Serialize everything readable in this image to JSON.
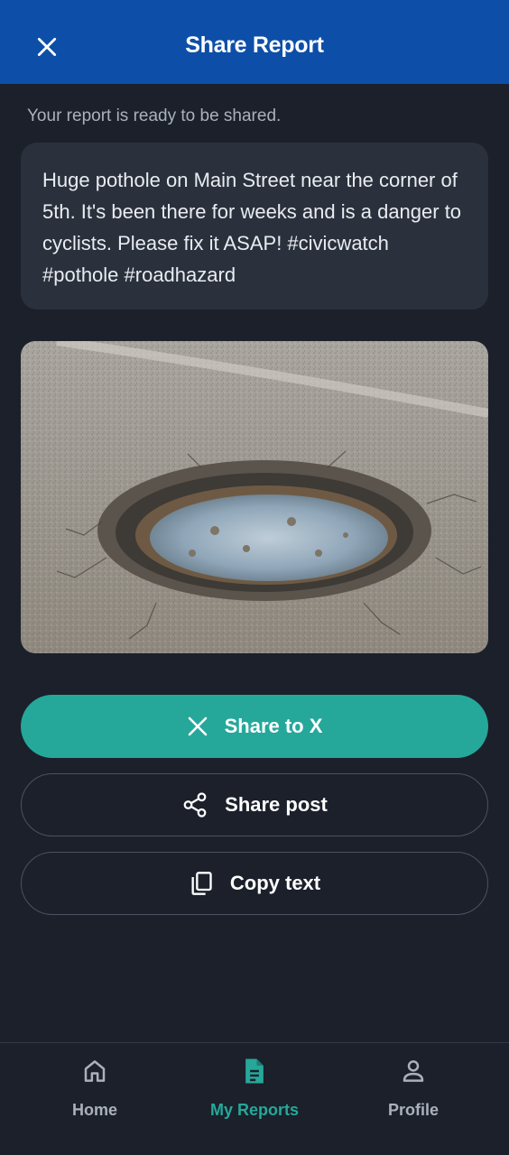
{
  "header": {
    "title": "Share Report",
    "close_icon": "close-icon"
  },
  "subtitle": "Your report is ready to be shared.",
  "report": {
    "text": "Huge pothole on Main Street near the corner of 5th. It's been there for weeks and is a danger to cyclists. Please fix it ASAP! #civicwatch #pothole #roadhazard"
  },
  "actions": {
    "share_x": {
      "label": "Share to X",
      "icon": "x-icon"
    },
    "share_post": {
      "label": "Share post",
      "icon": "share-icon"
    },
    "copy_text": {
      "label": "Copy text",
      "icon": "copy-icon"
    }
  },
  "nav": {
    "home": {
      "label": "Home",
      "icon": "home-icon"
    },
    "reports": {
      "label": "My Reports",
      "icon": "document-icon",
      "active": true
    },
    "profile": {
      "label": "Profile",
      "icon": "person-icon"
    }
  },
  "colors": {
    "header_bg": "#0d4fa8",
    "page_bg": "#1b202b",
    "card_bg": "#2b313c",
    "accent": "#25a89a",
    "muted_text": "#aab1bd"
  }
}
